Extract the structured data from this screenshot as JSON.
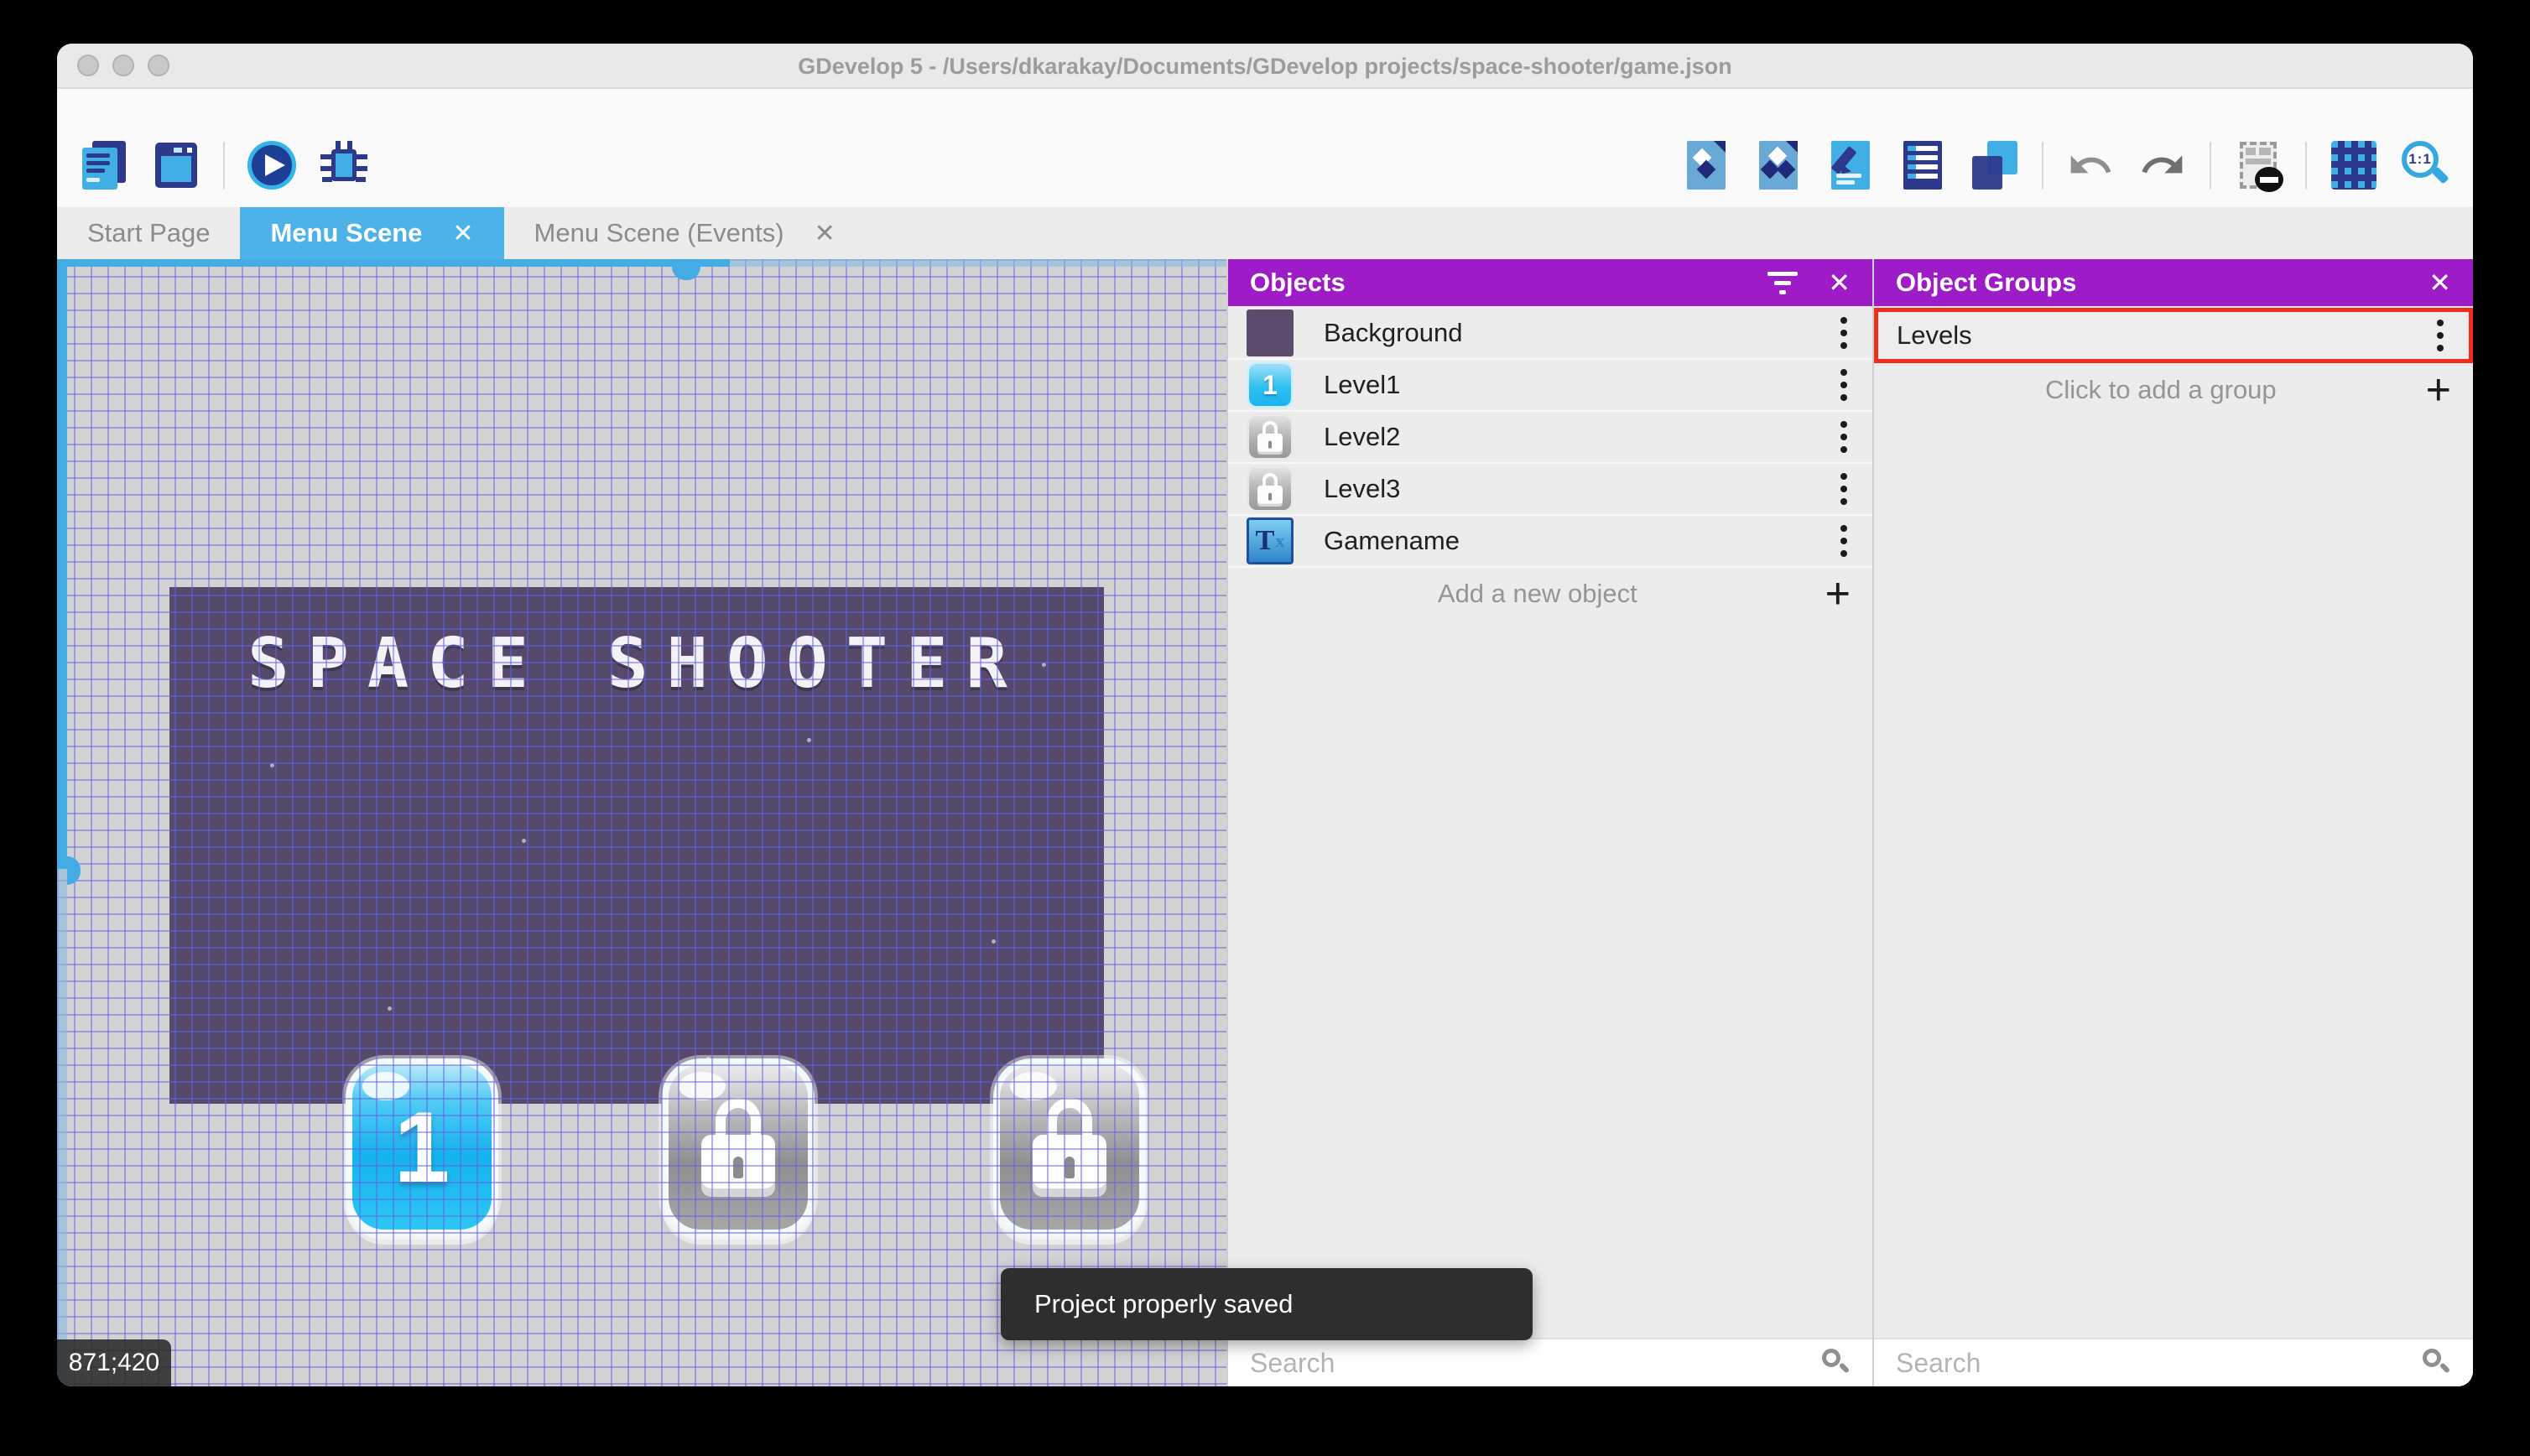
{
  "window": {
    "title": "GDevelop 5 - /Users/dkarakay/Documents/GDevelop projects/space-shooter/game.json"
  },
  "toolbar": {
    "left_icons": [
      "project-manager-icon",
      "scene-window-icon",
      "preview-play-icon",
      "debug-icon"
    ],
    "right_icons": [
      "objects-editor-icon",
      "object-groups-editor-icon",
      "properties-icon",
      "instances-list-icon",
      "layers-icon",
      "undo-icon",
      "redo-icon",
      "window-mask-icon",
      "grid-icon",
      "zoom-original-icon"
    ],
    "zoom_label": "1:1"
  },
  "tabs": [
    {
      "label": "Start Page",
      "active": false,
      "closable": false
    },
    {
      "label": "Menu Scene",
      "active": true,
      "closable": true
    },
    {
      "label": "Menu Scene (Events)",
      "active": false,
      "closable": true
    }
  ],
  "canvas": {
    "scene_title": "SPACE SHOOTER",
    "coordinates": "871;420",
    "level_buttons": [
      {
        "label": "1",
        "state": "unlocked"
      },
      {
        "label": "",
        "state": "locked"
      },
      {
        "label": "",
        "state": "locked"
      }
    ]
  },
  "objects_panel": {
    "title": "Objects",
    "items": [
      {
        "name": "Background",
        "thumb": "background-color-swatch"
      },
      {
        "name": "Level1",
        "thumb": "blue-button-1"
      },
      {
        "name": "Level2",
        "thumb": "locked-button"
      },
      {
        "name": "Level3",
        "thumb": "locked-button"
      },
      {
        "name": "Gamename",
        "thumb": "text-object"
      }
    ],
    "add_label": "Add a new object",
    "search_placeholder": "Search"
  },
  "groups_panel": {
    "title": "Object Groups",
    "items": [
      {
        "name": "Levels",
        "highlighted": true
      }
    ],
    "add_label": "Click to add a group",
    "search_placeholder": "Search"
  },
  "toast": {
    "message": "Project properly saved"
  },
  "colors": {
    "accent_blue": "#4cb2e8",
    "header_purple": "#9e1cc8",
    "highlight_red": "#ee2d1a",
    "scene_purple": "#57496b",
    "toast_bg": "#2e2e2e"
  }
}
